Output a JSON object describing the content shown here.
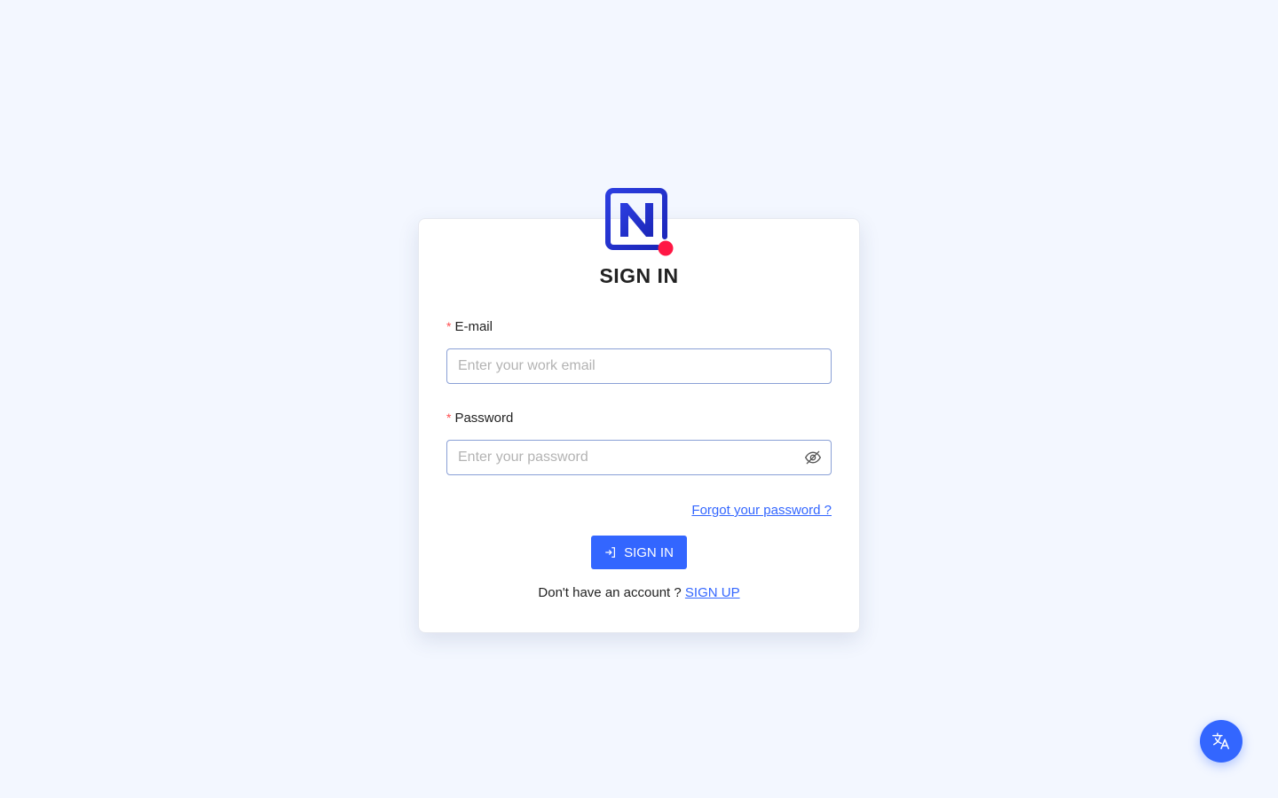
{
  "brand": {
    "logo_icon": "n-logo-icon",
    "primary_color": "#1f2fd1",
    "dot_color": "#ff1744",
    "accent_color": "#3366ff"
  },
  "form": {
    "title": "SIGN IN",
    "email": {
      "required_mark": "*",
      "label": "E-mail",
      "placeholder": "Enter your work email",
      "value": ""
    },
    "password": {
      "required_mark": "*",
      "label": "Password",
      "placeholder": "Enter your password",
      "value": "",
      "toggle_icon": "eye-off-icon"
    },
    "forgot_label": "Forgot your password ?",
    "submit_label": "SIGN IN",
    "submit_icon": "login-icon",
    "signup_prompt": "Don't have an account ?",
    "signup_label": "SIGN UP"
  },
  "language_button": {
    "icon": "translate-icon"
  }
}
